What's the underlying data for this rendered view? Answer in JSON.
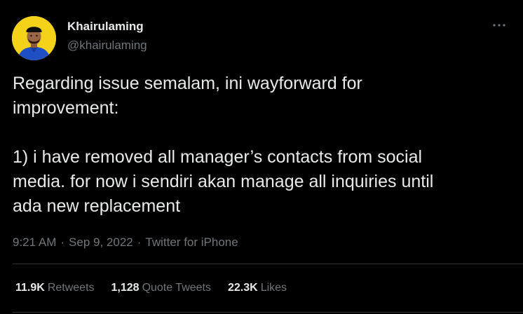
{
  "author": {
    "display_name": "Khairulaming",
    "handle": "@khairulaming"
  },
  "tweet": {
    "text": "Regarding issue semalam, ini wayforward for\nimprovement:\n\n1) i have removed all manager’s contacts from social\nmedia. for now i sendiri akan manage all inquiries until\nada new replacement",
    "time": "9:21 AM",
    "date": "Sep 9, 2022",
    "source": "Twitter for iPhone",
    "separator": "·"
  },
  "stats": {
    "retweets": {
      "count": "11.9K",
      "label": "Retweets"
    },
    "quote_tweets": {
      "count": "1,128",
      "label": "Quote Tweets"
    },
    "likes": {
      "count": "22.3K",
      "label": "Likes"
    }
  },
  "icons": {
    "more": "more-options-icon",
    "avatar": "profile-avatar"
  },
  "colors": {
    "background": "#000000",
    "text": "#e7e9ea",
    "secondary_text": "#71767b",
    "divider": "#2f3336",
    "avatar_bg": "#f5d21a"
  }
}
